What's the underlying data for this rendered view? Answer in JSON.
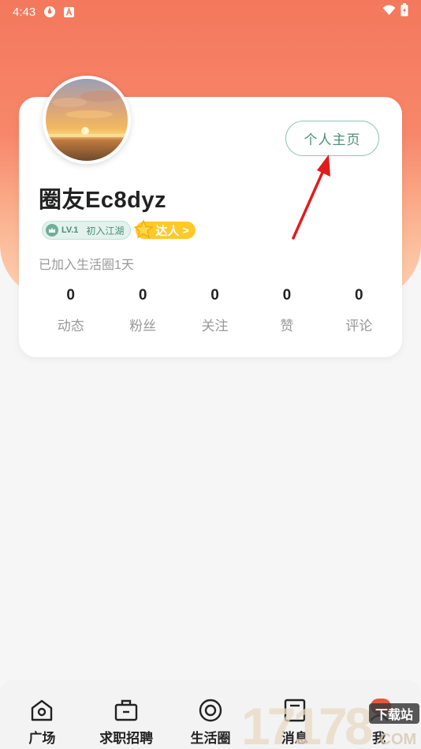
{
  "status_bar": {
    "time": "4:43",
    "icons": [
      "settings-icon",
      "a-icon",
      "wifi-icon",
      "battery-icon"
    ]
  },
  "profile": {
    "nickname": "圈友Ec8dyz",
    "home_button_label": "个人主页",
    "level": "LV.1",
    "level_title": "初入江湖",
    "expert_label": "达人",
    "expert_chevron": ">",
    "joined_text": "已加入生活圈1天"
  },
  "stats": [
    {
      "value": "0",
      "label": "动态"
    },
    {
      "value": "0",
      "label": "粉丝"
    },
    {
      "value": "0",
      "label": "关注"
    },
    {
      "value": "0",
      "label": "赞"
    },
    {
      "value": "0",
      "label": "评论"
    }
  ],
  "bottom_nav": [
    {
      "label": "广场",
      "icon": "home-icon"
    },
    {
      "label": "求职招聘",
      "icon": "briefcase-icon"
    },
    {
      "label": "生活圈",
      "icon": "circle-icon"
    },
    {
      "label": "消息",
      "icon": "message-icon"
    },
    {
      "label": "我",
      "icon": "user-icon"
    }
  ],
  "watermark": {
    "text_main": "17178",
    "text_sub": "下载站",
    "text_com": ".COM"
  },
  "colors": {
    "header_gradient_top": "#f4785c",
    "header_gradient_bottom": "#fdd3b5",
    "accent_green": "#4e8c79",
    "expert_yellow": "#ffc928",
    "arrow_red": "#e21b1b"
  }
}
